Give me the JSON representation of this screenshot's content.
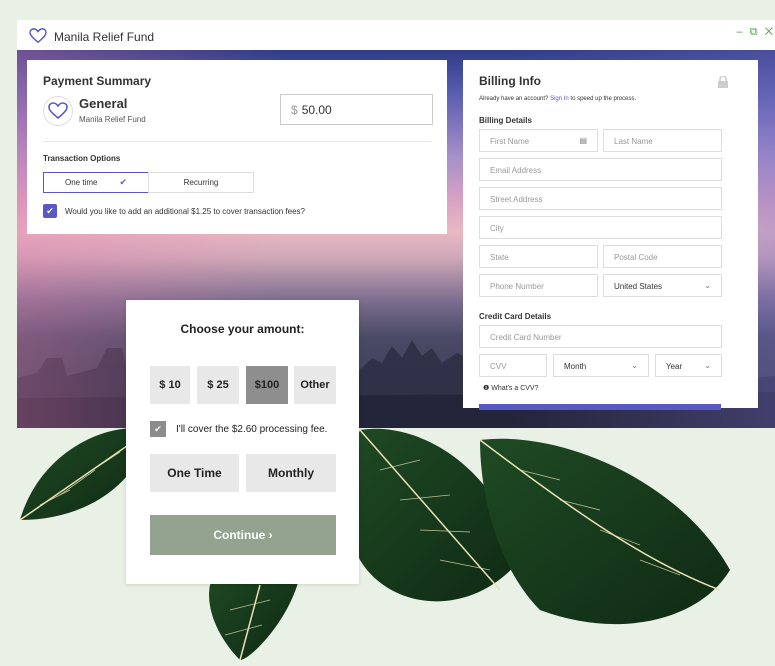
{
  "window": {
    "controls": "– ⧉ ✕"
  },
  "app": {
    "title": "Manila Relief Fund",
    "icon": "heart-icon"
  },
  "payment_summary": {
    "title": "Payment Summary",
    "fund_name": "General",
    "fund_sub": "Manila Relief Fund",
    "currency": "$",
    "amount": "50.00",
    "transaction_options_label": "Transaction Options",
    "options": [
      "One time",
      "Recurring"
    ],
    "selected_option": "One time",
    "fee_text": "Would you like to add an additional $1.25 to cover transaction fees?",
    "fee_checked": true
  },
  "billing": {
    "title": "Billing Info",
    "account_prompt": "Already have an account?",
    "sign_in": "Sign In",
    "account_suffix": "to speed up the process.",
    "billing_details_label": "Billing Details",
    "placeholders": {
      "first_name": "First Name",
      "last_name": "Last Name",
      "email": "Email Address",
      "street": "Street Address",
      "city": "City",
      "state": "State",
      "postal": "Postal Code",
      "phone": "Phone Number"
    },
    "country": "United States",
    "credit_card_label": "Credit Card Details",
    "card_placeholder": "Credit Card Number",
    "cvv_placeholder": "CVV",
    "month": "Month",
    "year": "Year",
    "cvv_help": "What's a CVV?"
  },
  "amount_card": {
    "title": "Choose your amount:",
    "amounts": [
      "$ 10",
      "$ 25",
      "$100",
      "Other"
    ],
    "selected_amount": "$100",
    "cover_text": "I'll cover the $2.60 processing fee.",
    "cover_checked": true,
    "frequencies": [
      "One Time",
      "Monthly"
    ],
    "continue_label": "Continue ›"
  },
  "colors": {
    "accent": "#5a58c5",
    "continue": "#93a38f",
    "background": "#e9f0e6"
  }
}
